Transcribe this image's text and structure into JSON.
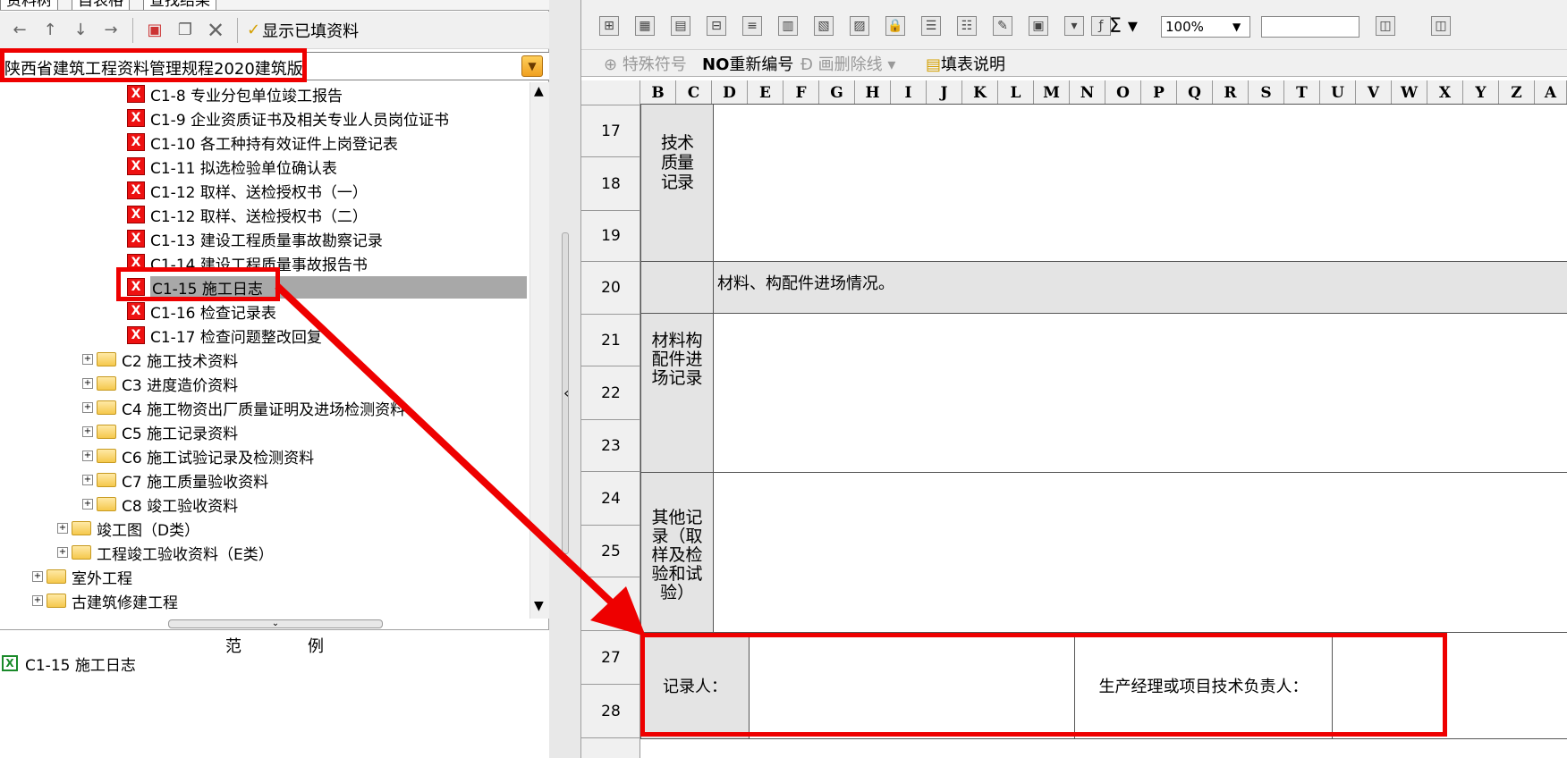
{
  "left_panel": {
    "tabs": [
      "资料树",
      "自表格",
      "查找结果"
    ],
    "toolbar": {
      "show_filled_label": "显示已填资料"
    },
    "spec_combo": {
      "value": "陕西省建筑工程资料管理规程2020建筑版"
    },
    "tree_items": [
      {
        "label": "C1-8 专业分包单位竣工报告",
        "type": "form"
      },
      {
        "label": "C1-9 企业资质证书及相关专业人员岗位证书",
        "type": "form"
      },
      {
        "label": "C1-10 各工种持有效证件上岗登记表",
        "type": "form"
      },
      {
        "label": "C1-11 拟选检验单位确认表",
        "type": "form"
      },
      {
        "label": "C1-12 取样、送检授权书（一）",
        "type": "form"
      },
      {
        "label": "C1-12 取样、送检授权书（二）",
        "type": "form"
      },
      {
        "label": "C1-13 建设工程质量事故勘察记录",
        "type": "form"
      },
      {
        "label": "C1-14 建设工程质量事故报告书",
        "type": "form"
      },
      {
        "label": "C1-15 施工日志",
        "type": "form",
        "selected": true
      },
      {
        "label": "C1-16 检查记录表",
        "type": "form"
      },
      {
        "label": "C1-17 检查问题整改回复",
        "type": "form"
      },
      {
        "label": "C2 施工技术资料",
        "type": "folder"
      },
      {
        "label": "C3 进度造价资料",
        "type": "folder"
      },
      {
        "label": "C4 施工物资出厂质量证明及进场检测资料",
        "type": "folder"
      },
      {
        "label": "C5 施工记录资料",
        "type": "folder"
      },
      {
        "label": "C6 施工试验记录及检测资料",
        "type": "folder"
      },
      {
        "label": "C7 施工质量验收资料",
        "type": "folder"
      },
      {
        "label": "C8 竣工验收资料",
        "type": "folder"
      },
      {
        "label": "竣工图（D类）",
        "type": "folder"
      },
      {
        "label": "工程竣工验收资料（E类）",
        "type": "folder"
      },
      {
        "label": "室外工程",
        "type": "folder"
      },
      {
        "label": "古建筑修建工程",
        "type": "folder"
      }
    ],
    "sample": {
      "header_left": "范",
      "header_right": "例",
      "item": "C1-15 施工日志"
    }
  },
  "right_panel": {
    "toolbar": {
      "zoom": "100%",
      "special_symbol_label": "特殊符号",
      "renumber_label": "重新编号",
      "strikethrough_label": "画删除线",
      "fill_help_label": "填表说明"
    },
    "columns": [
      "B",
      "C",
      "D",
      "E",
      "F",
      "G",
      "H",
      "I",
      "J",
      "K",
      "L",
      "M",
      "N",
      "O",
      "P",
      "Q",
      "R",
      "S",
      "T",
      "U",
      "V",
      "W",
      "X",
      "Y",
      "Z",
      "A"
    ],
    "rows": [
      "17",
      "18",
      "19",
      "20",
      "21",
      "22",
      "23",
      "24",
      "25",
      "26",
      "27",
      "28"
    ],
    "sheet": {
      "tech_quality_label": "技术质量记录",
      "materials_entry_text": "材料、构配件进场情况。",
      "materials_label": "材料构配件进场记录",
      "other_label": "其他记录（取样及检验和试验）",
      "recorder_label": "记录人：",
      "manager_label": "生产经理或项目技术负责人："
    }
  },
  "colors": {
    "highlight": "#e00000",
    "selection": "#a8a8a8"
  }
}
